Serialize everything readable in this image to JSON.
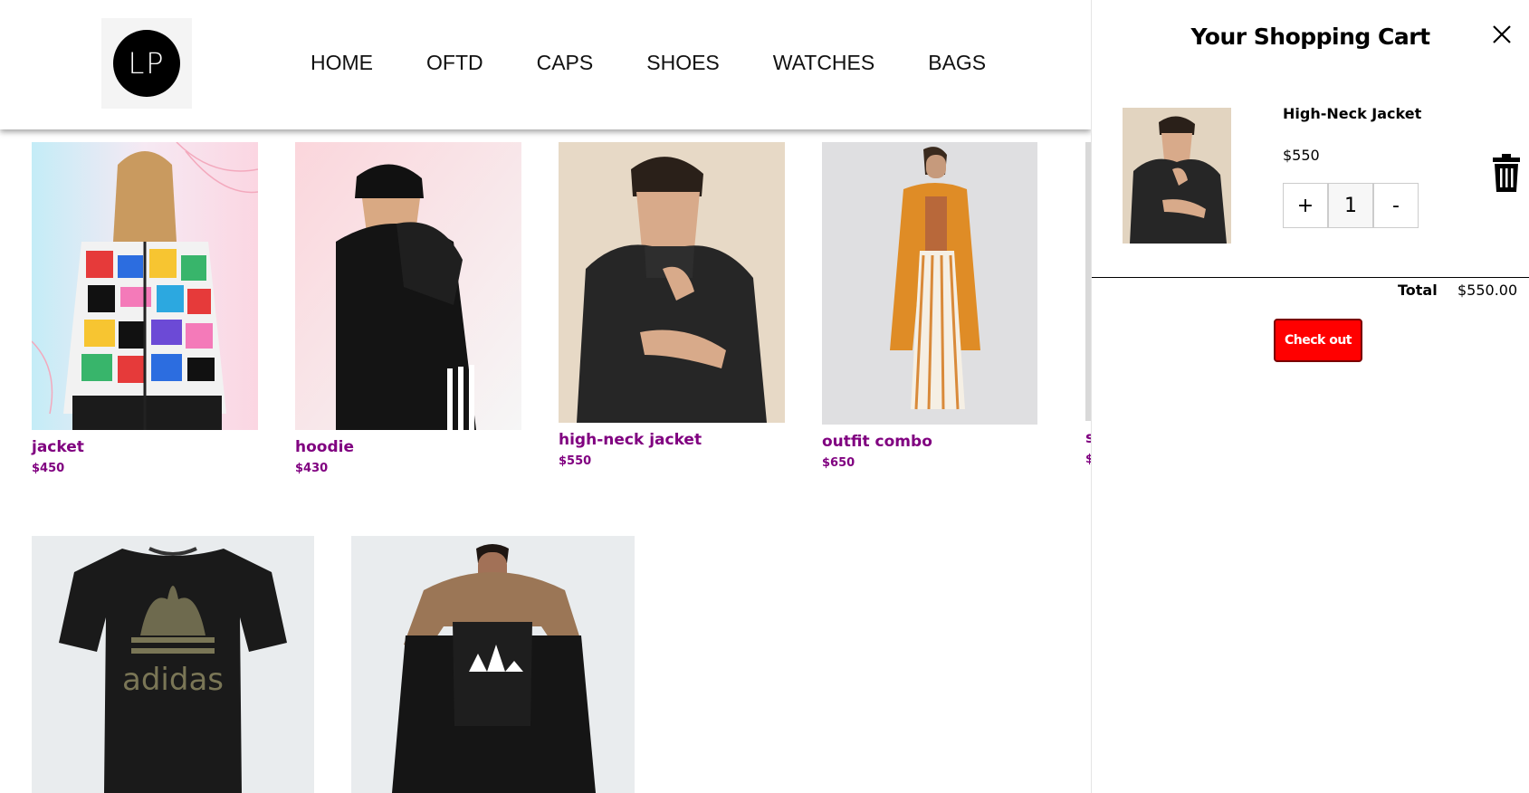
{
  "brand": {
    "logo_text": "LP"
  },
  "nav": {
    "items": [
      "HOME",
      "OFTD",
      "CAPS",
      "SHOES",
      "WATCHES",
      "BAGS"
    ]
  },
  "products": [
    {
      "name": "jacket",
      "price": "$450"
    },
    {
      "name": "hoodie",
      "price": "$430"
    },
    {
      "name": "high-neck jacket",
      "price": "$550"
    },
    {
      "name": "outfit combo",
      "price": "$650"
    },
    {
      "name": "s",
      "price": "$"
    }
  ],
  "cart": {
    "title": "Your Shopping Cart",
    "item": {
      "name": "High-Neck Jacket",
      "price": "$550",
      "quantity": "1",
      "plus": "+",
      "minus": "-"
    },
    "total_label": "Total",
    "total_value": "$550.00",
    "checkout_label": "Check out"
  },
  "colors": {
    "accent": "#800080",
    "checkout": "#ff0000"
  }
}
